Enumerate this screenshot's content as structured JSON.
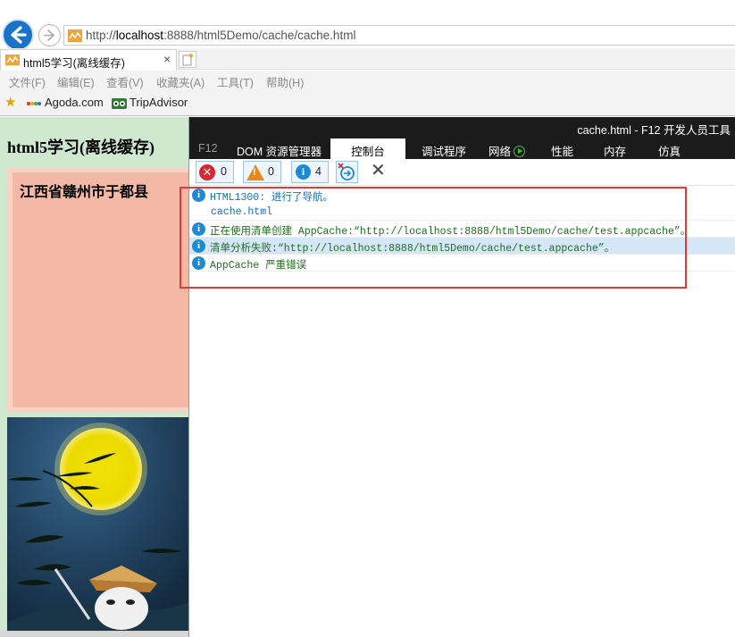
{
  "browser": {
    "url_prefix": "http://",
    "url_host": "localhost",
    "url_rest": ":8888/html5Demo/cache/cache.html",
    "tab_title": "html5学习(离线缓存)",
    "tab_close": "×",
    "menu": [
      "文件(F)",
      "编辑(E)",
      "查看(V)",
      "收藏夹(A)",
      "工具(T)",
      "帮助(H)"
    ],
    "favorites": [
      "Agoda.com",
      "TripAdvisor"
    ]
  },
  "page": {
    "title": "html5学习(离线缓存)",
    "box_text": "江西省赣州市于都县"
  },
  "devtools": {
    "window_title": "cache.html - F12 开发人员工具",
    "tabs": [
      "F12",
      "DOM 资源管理器",
      "控制台",
      "调试程序",
      "网络",
      "性能",
      "内存",
      "仿真"
    ],
    "active_tab": "控制台",
    "counts": {
      "errors": "0",
      "warnings": "0",
      "messages": "4"
    },
    "console": [
      {
        "code": "HTML1300: 进行了导航。",
        "sub": "cache.html",
        "highlight": false
      },
      {
        "text": "正在使用清单创建 AppCache:“http://localhost:8888/html5Demo/cache/test.appcache”。",
        "highlight": false
      },
      {
        "text": "清单分析失败:“http://localhost:8888/html5Demo/cache/test.appcache”。",
        "highlight": true
      },
      {
        "text": "AppCache 严重错误",
        "highlight": false
      }
    ]
  },
  "colors": {
    "page_bg": "#cfe8d0",
    "pink_box": "#f4b9a6",
    "devtools_dark": "#1b1b1b",
    "info_blue": "#1c8bd6",
    "console_green": "#1f6d1f",
    "annotation_red": "#e03a3a"
  },
  "icons": [
    "back-arrow-icon",
    "forward-arrow-icon",
    "favicon-icon",
    "new-tab-icon",
    "favorites-star-icon",
    "error-icon",
    "warning-icon",
    "info-icon",
    "clear-on-navigate-icon",
    "clear-console-icon",
    "play-icon"
  ]
}
